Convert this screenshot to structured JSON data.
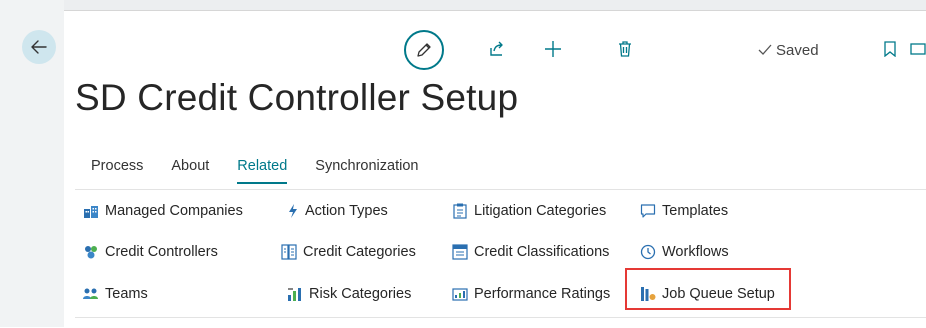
{
  "window": {
    "page_title": "SD Credit Controller Setup",
    "status": "Saved"
  },
  "icons": {
    "back": "arrow-left-icon",
    "edit": "pencil-icon",
    "share": "share-icon",
    "add": "plus-icon",
    "delete": "trash-icon",
    "saved": "checkmark-icon",
    "bookmark": "bookmark-icon",
    "more": "window-icon"
  },
  "tabs": [
    {
      "label": "Process",
      "active": false
    },
    {
      "label": "About",
      "active": false
    },
    {
      "label": "Related",
      "active": true
    },
    {
      "label": "Synchronization",
      "active": false
    }
  ],
  "actions": {
    "col1": [
      {
        "label": "Managed Companies",
        "icon": "companies-icon"
      },
      {
        "label": "Credit Controllers",
        "icon": "controllers-icon"
      },
      {
        "label": "Teams",
        "icon": "teams-icon"
      }
    ],
    "col2": [
      {
        "label": "Action Types",
        "icon": "lightning-icon"
      },
      {
        "label": "Credit Categories",
        "icon": "credit-categories-icon"
      },
      {
        "label": "Risk Categories",
        "icon": "risk-categories-icon"
      }
    ],
    "col3": [
      {
        "label": "Litigation Categories",
        "icon": "litigation-icon"
      },
      {
        "label": "Credit Classifications",
        "icon": "classifications-icon"
      },
      {
        "label": "Performance Ratings",
        "icon": "performance-icon"
      }
    ],
    "col4": [
      {
        "label": "Templates",
        "icon": "templates-icon"
      },
      {
        "label": "Workflows",
        "icon": "workflows-icon"
      },
      {
        "label": "Job Queue Setup",
        "icon": "job-queue-icon",
        "highlighted": true
      }
    ]
  },
  "colors": {
    "accent": "#00798a",
    "highlight": "#e53935",
    "back_button_bg": "#cfe6ee"
  }
}
